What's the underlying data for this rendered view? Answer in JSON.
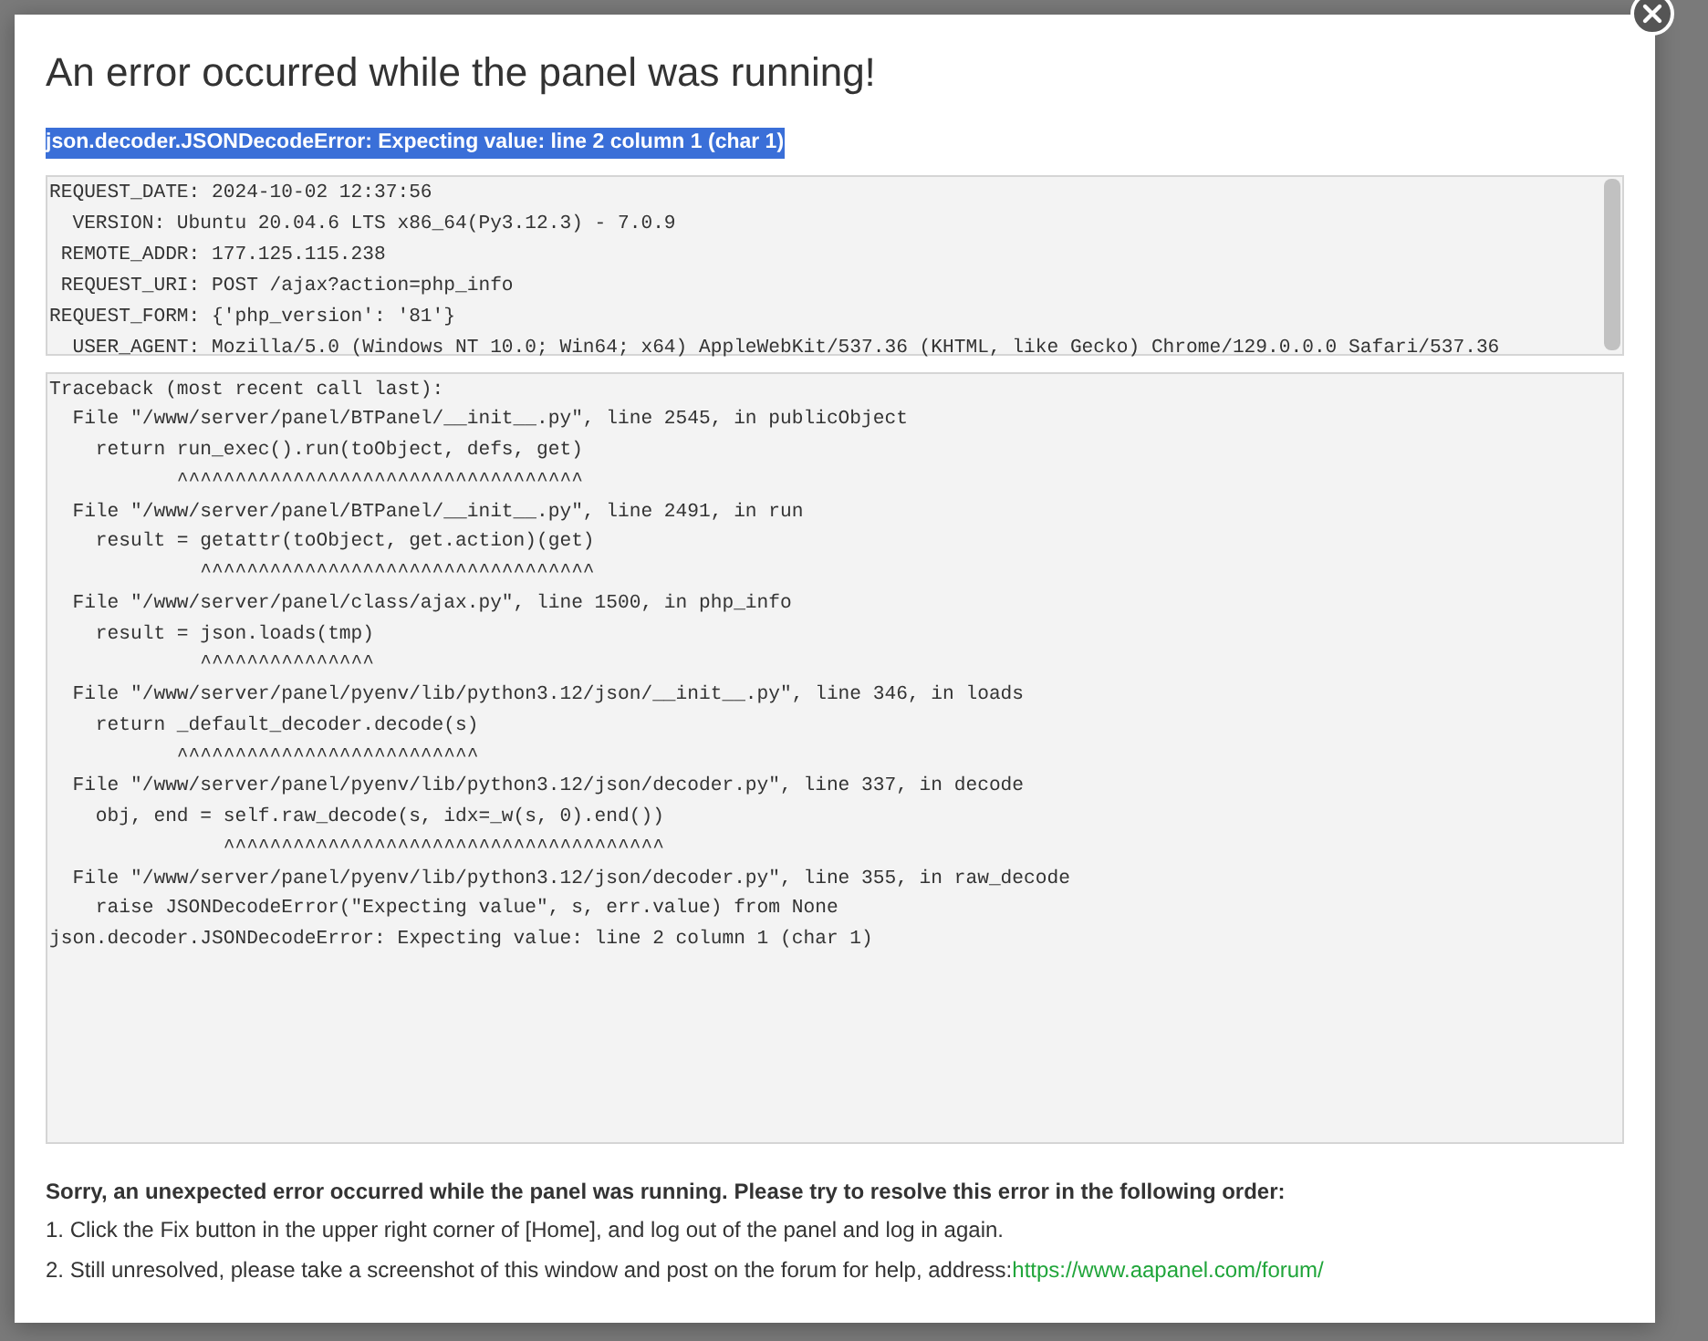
{
  "dialog": {
    "title": "An error occurred while the panel was running!",
    "error_summary": {
      "text": "json.decoder.JSONDecodeError: Expecting value: line 2 column 1 (char 1)",
      "highlighted": true
    },
    "request_info": [
      "REQUEST_DATE: 2024-10-02 12:37:56",
      "  VERSION: Ubuntu 20.04.6 LTS x86_64(Py3.12.3) - 7.0.9",
      " REMOTE_ADDR: 177.125.115.238",
      " REQUEST_URI: POST /ajax?action=php_info",
      "REQUEST_FORM: {'php_version': '81'}",
      "  USER_AGENT: Mozilla/5.0 (Windows NT 10.0; Win64; x64) AppleWebKit/537.36 (KHTML, like Gecko) Chrome/129.0.0.0 Safari/537.36"
    ],
    "traceback": [
      "Traceback (most recent call last):",
      "  File \"/www/server/panel/BTPanel/__init__.py\", line 2545, in publicObject",
      "    return run_exec().run(toObject, defs, get)",
      "           ^^^^^^^^^^^^^^^^^^^^^^^^^^^^^^^^^^^",
      "  File \"/www/server/panel/BTPanel/__init__.py\", line 2491, in run",
      "    result = getattr(toObject, get.action)(get)",
      "             ^^^^^^^^^^^^^^^^^^^^^^^^^^^^^^^^^^",
      "  File \"/www/server/panel/class/ajax.py\", line 1500, in php_info",
      "    result = json.loads(tmp)",
      "             ^^^^^^^^^^^^^^^",
      "  File \"/www/server/panel/pyenv/lib/python3.12/json/__init__.py\", line 346, in loads",
      "    return _default_decoder.decode(s)",
      "           ^^^^^^^^^^^^^^^^^^^^^^^^^^",
      "  File \"/www/server/panel/pyenv/lib/python3.12/json/decoder.py\", line 337, in decode",
      "    obj, end = self.raw_decode(s, idx=_w(s, 0).end())",
      "               ^^^^^^^^^^^^^^^^^^^^^^^^^^^^^^^^^^^^^^",
      "  File \"/www/server/panel/pyenv/lib/python3.12/json/decoder.py\", line 355, in raw_decode",
      "    raise JSONDecodeError(\"Expecting value\", s, err.value) from None",
      "json.decoder.JSONDecodeError: Expecting value: line 2 column 1 (char 1)"
    ],
    "help_heading": "Sorry, an unexpected error occurred while the panel was running. Please try to resolve this error in the following order:",
    "help_steps": [
      {
        "text": "1. Click the Fix button in the upper right corner of [Home], and log out of the panel and log in again."
      },
      {
        "text": "2. Still unresolved, please take a screenshot of this window and post on the forum for help, address:",
        "link": "https://www.aapanel.com/forum/"
      }
    ]
  }
}
